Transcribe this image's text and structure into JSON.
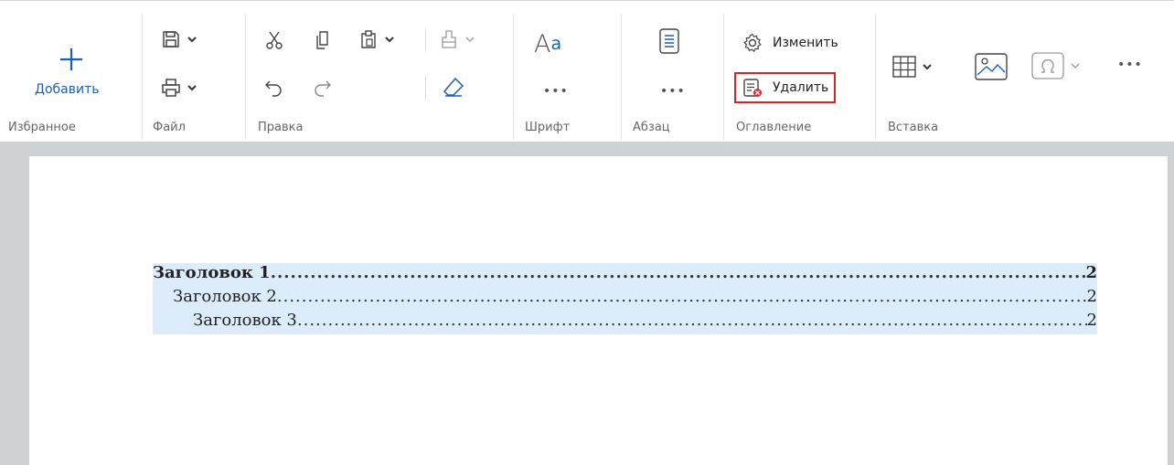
{
  "toolbar": {
    "groups": {
      "favorites": "Избранное",
      "file": "Файл",
      "edit": "Правка",
      "font": "Шрифт",
      "paragraph": "Абзац",
      "toc": "Оглавление",
      "insert": "Вставка"
    },
    "add_label": "Добавить",
    "font_button": "Aa",
    "more": "•••",
    "toc_change": "Изменить",
    "toc_delete": "Удалить",
    "icons": [
      "save-icon",
      "print-icon",
      "cut-icon",
      "copy-icon",
      "paste-icon",
      "undo-icon",
      "redo-icon",
      "format-painter-icon",
      "eraser-icon",
      "paragraph-icon",
      "settings-icon",
      "delete-toc-icon",
      "table-icon",
      "image-icon",
      "special-char-icon"
    ],
    "colors": {
      "accent": "#1a5fb4",
      "highlight_border": "#d8252a",
      "toc_highlight": "#dcecfb"
    }
  },
  "document": {
    "toc": [
      {
        "text": "Заголовок 1",
        "page": "2",
        "level": 1
      },
      {
        "text": "Заголовок 2",
        "page": "2",
        "level": 2
      },
      {
        "text": "Заголовок 3",
        "page": "2",
        "level": 3
      }
    ]
  }
}
